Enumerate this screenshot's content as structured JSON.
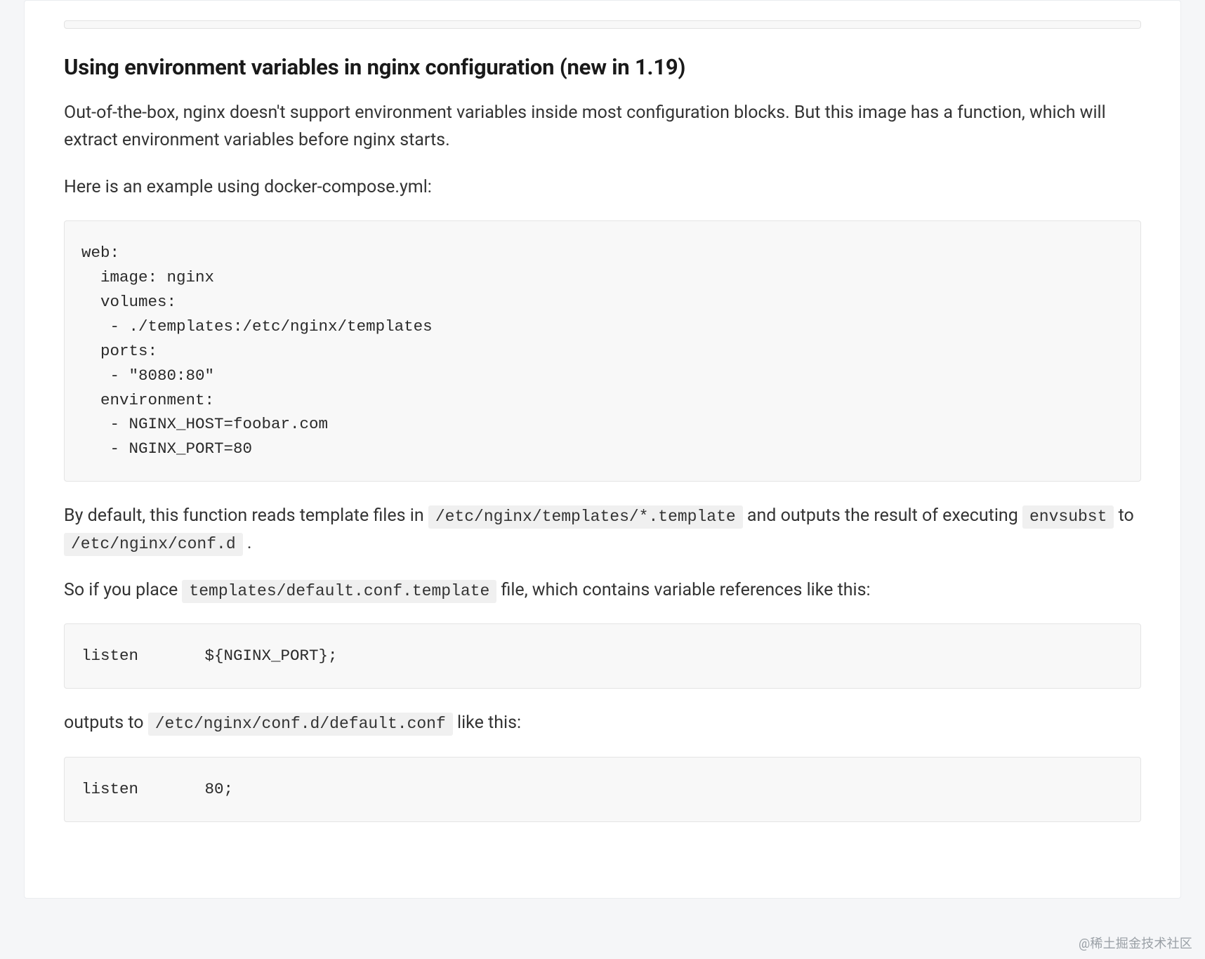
{
  "heading": "Using environment variables in nginx configuration (new in 1.19)",
  "para1": "Out-of-the-box, nginx doesn't support environment variables inside most configuration blocks. But this image has a function, which will extract environment variables before nginx starts.",
  "para2": "Here is an example using docker-compose.yml:",
  "code1": "web:\n  image: nginx\n  volumes:\n   - ./templates:/etc/nginx/templates\n  ports:\n   - \"8080:80\"\n  environment:\n   - NGINX_HOST=foobar.com\n   - NGINX_PORT=80",
  "para3a": "By default, this function reads template files in ",
  "inline1": "/etc/nginx/templates/*.template",
  "para3b": " and outputs the result of executing ",
  "inline2": "envsubst",
  "para3c": " to ",
  "inline3": "/etc/nginx/conf.d",
  "para3d": ".",
  "para4a": "So if you place ",
  "inline4": "templates/default.conf.template",
  "para4b": " file, which contains variable references like this:",
  "code2": "listen       ${NGINX_PORT};",
  "para5a": "outputs to ",
  "inline5": "/etc/nginx/conf.d/default.conf",
  "para5b": " like this:",
  "code3": "listen       80;",
  "watermark": "@稀土掘金技术社区"
}
